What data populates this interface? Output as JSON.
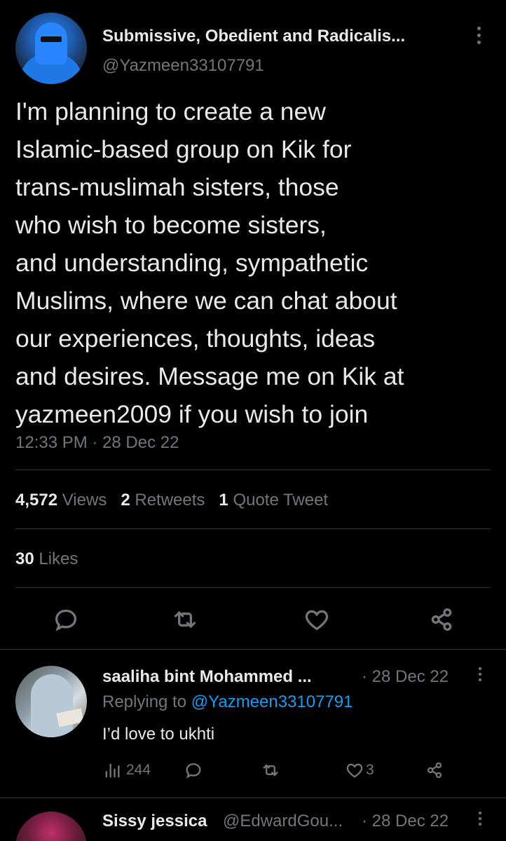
{
  "tweet": {
    "display_name": "Submissive, Obedient and Radicalis...",
    "handle": "@Yazmeen33107791",
    "text_lines": [
      "I'm planning to create a new",
      "Islamic-based group on Kik for",
      "trans-muslimah sisters, those",
      "who wish to become sisters,",
      "and understanding, sympathetic",
      "Muslims, where we can chat about",
      "our experiences, thoughts, ideas",
      "and desires. Message me on Kik at",
      "yazmeen2009 if you wish to join"
    ],
    "timestamp": "12:33 PM · 28 Dec 22",
    "stats": {
      "views_count": "4,572",
      "views_label": "Views",
      "retweets_count": "2",
      "retweets_label": "Retweets",
      "quotes_count": "1",
      "quotes_label": "Quote Tweet",
      "likes_count": "30",
      "likes_label": "Likes"
    },
    "actions": [
      "reply-icon",
      "retweet-icon",
      "like-icon",
      "share-icon"
    ]
  },
  "replies": [
    {
      "display_name": "saaliha bint Mohammed ...",
      "date": "· 28 Dec 22",
      "replying_prefix": "Replying to",
      "replying_handle": "@Yazmeen33107791",
      "text": "I’d love to ukhti",
      "views": "244",
      "likes": "3"
    },
    {
      "display_name": "Sissy jessica",
      "handle": "@EdwardGou...",
      "date": "· 28 Dec 22"
    }
  ],
  "colors": {
    "background": "#000000",
    "text": "#e7e9ea",
    "muted": "#71767b",
    "accent": "#1d9bf0",
    "divider": "#2f3336"
  }
}
